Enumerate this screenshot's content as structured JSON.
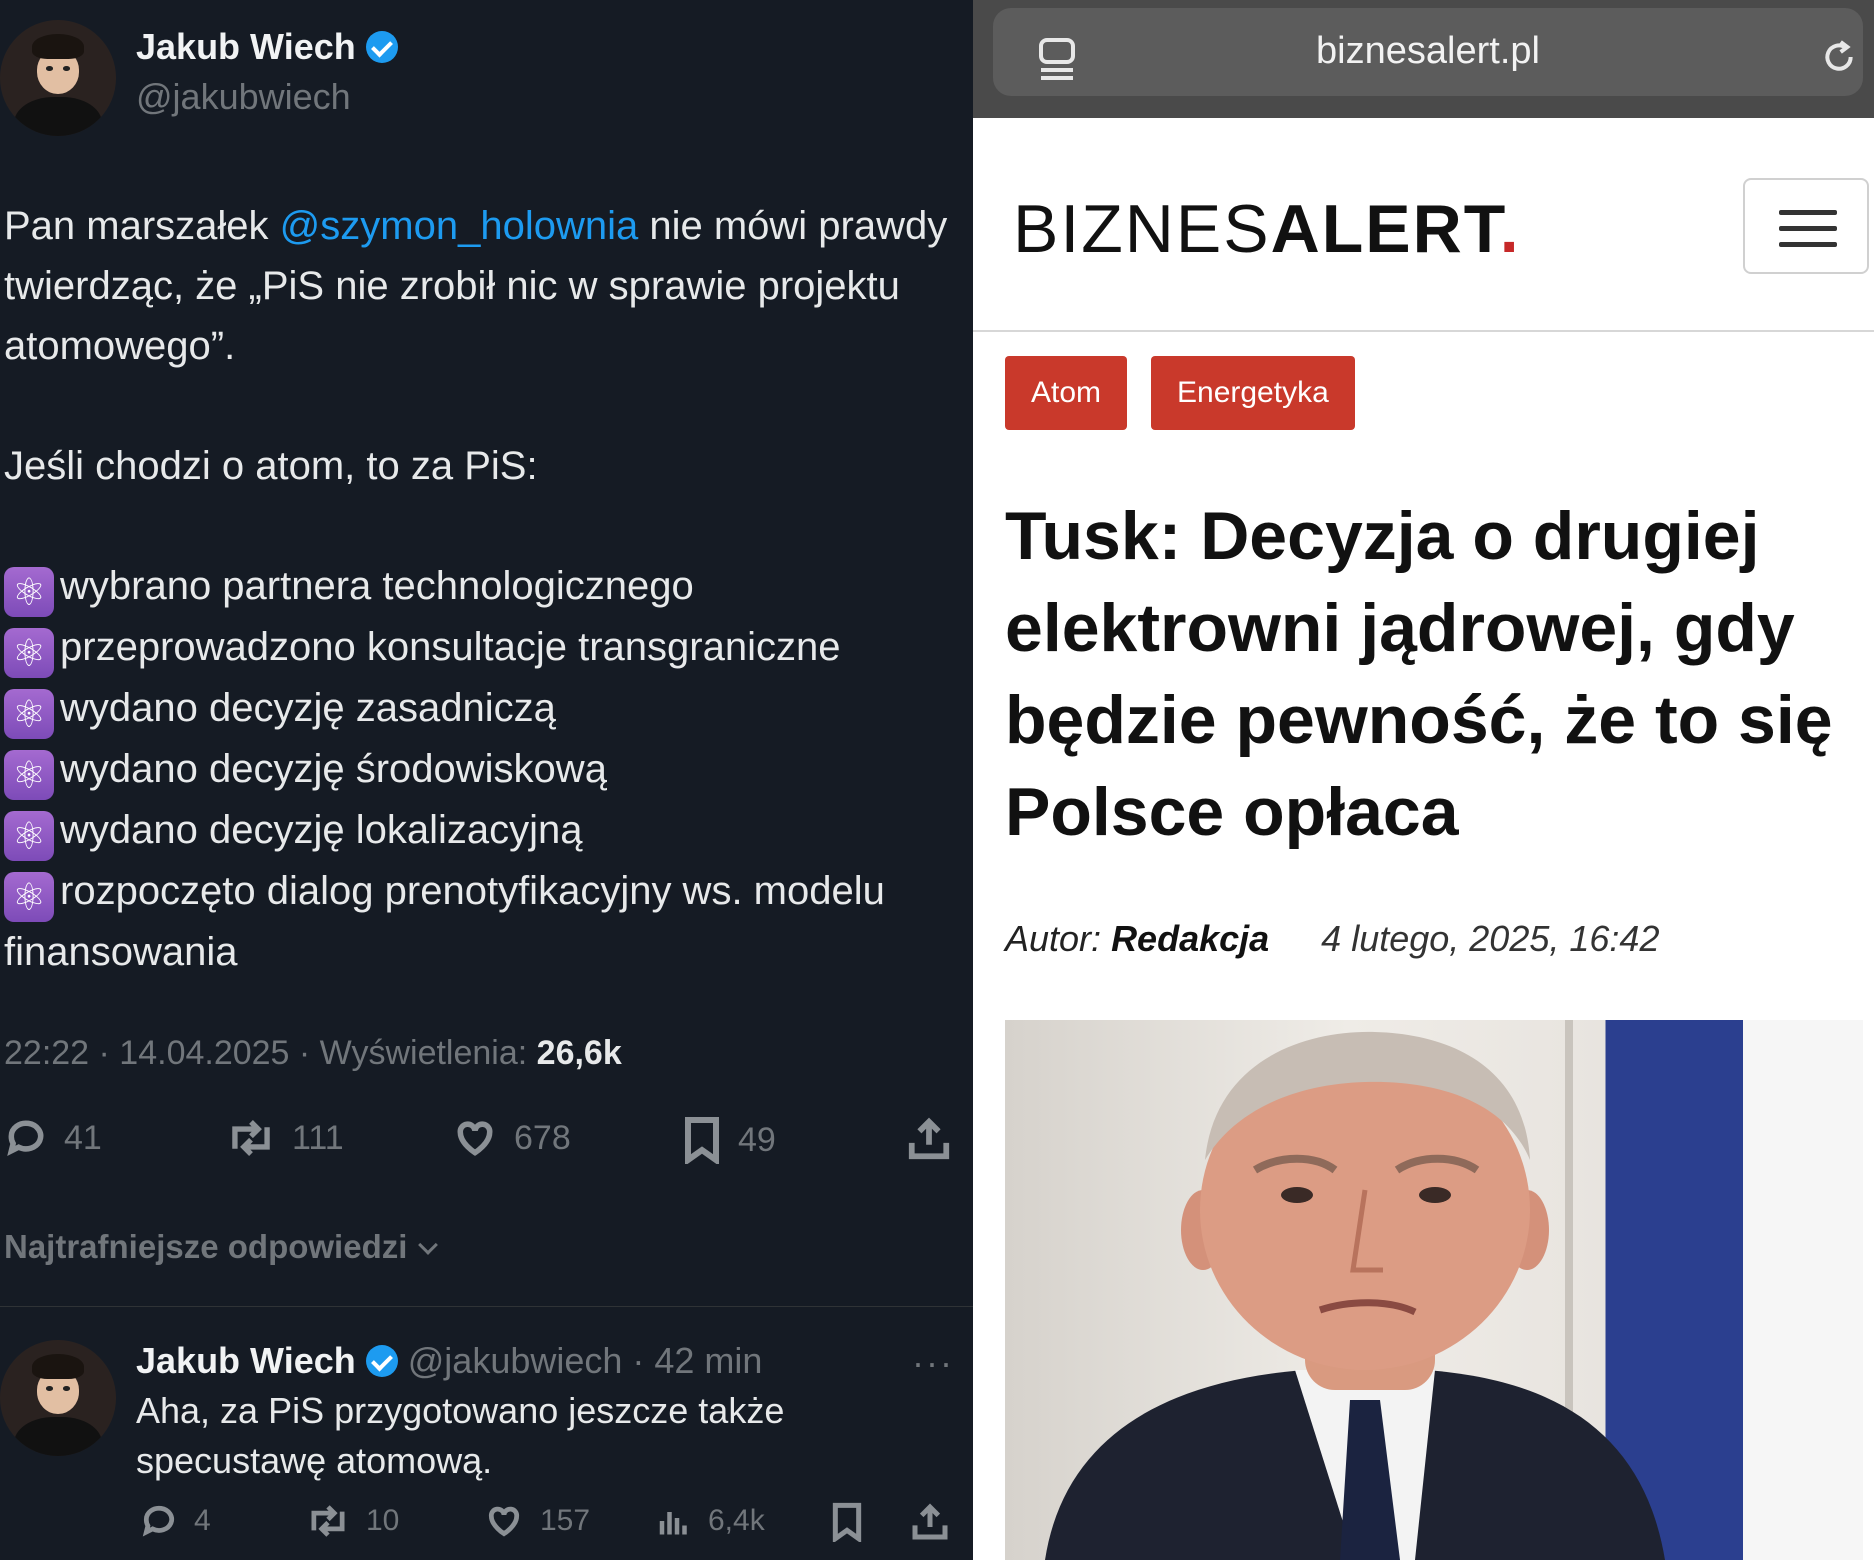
{
  "tweet": {
    "author_name": "Jakub Wiech",
    "author_handle": "@jakubwiech",
    "text_before_mention": "Pan marszałek ",
    "mention": "@szymon_holownia",
    "text_after_mention": " nie mówi prawdy twierdząc, że „PiS nie zrobił nic w sprawie projektu atomowego”.",
    "intro": "Jeśli chodzi o atom, to za PiS:",
    "bullet_emoji": "⚛",
    "bullets": [
      "wybrano partnera technologicznego",
      "przeprowadzono konsultacje transgraniczne",
      "wydano decyzję zasadniczą",
      "wydano decyzję środowiskową",
      "wydano decyzję lokalizacyjną",
      "rozpoczęto dialog prenotyfikacyjny ws. modelu finansowania"
    ],
    "timestamp": "22:22 · 14.04.2025 · Wyświetlenia: ",
    "views": "26,6k",
    "replies": "41",
    "retweets": "111",
    "likes": "678",
    "bookmarks": "49"
  },
  "replies_sort_label": "Najtrafniejsze odpowiedzi",
  "reply": {
    "author_name": "Jakub Wiech",
    "meta": "@jakubwiech · 42 min",
    "more": "···",
    "text": "Aha, za PiS przygotowano jeszcze także specustawę atomową.",
    "replies": "4",
    "retweets": "10",
    "likes": "157",
    "views": "6,4k"
  },
  "browser": {
    "url": "biznesalert.pl"
  },
  "site": {
    "logo_thin": "BIZNES",
    "logo_bold": "ALERT",
    "logo_dot": ".",
    "tags": [
      "Atom",
      "Energetyka"
    ],
    "headline": "Tusk: Decyzja o drugiej elektrowni jądrowej, gdy będzie pewność, że to się Polsce opłaca",
    "author_label": "Autor: ",
    "author": "Redakcja",
    "date": "4 lutego, 2025, 16:42"
  },
  "colors": {
    "tweet_bg": "#151b24",
    "link_blue": "#1d9bf0",
    "tag_red": "#c9392b",
    "muted": "#71767b"
  }
}
